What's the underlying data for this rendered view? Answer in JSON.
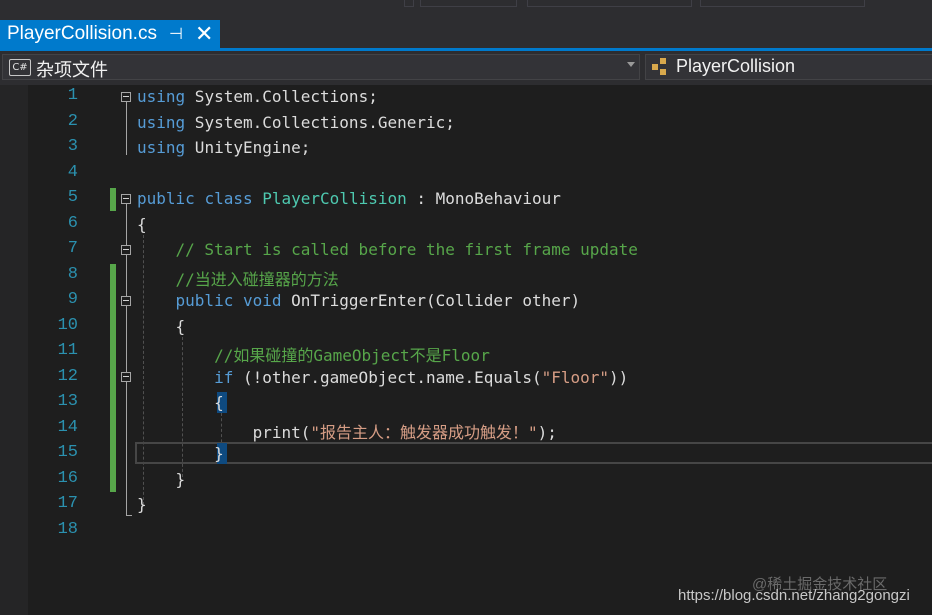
{
  "tab": {
    "filename": "PlayerCollision.cs",
    "pin_glyph": "⊣",
    "close_glyph": "✕"
  },
  "navigation": {
    "project_dropdown": {
      "icon": "C#",
      "label": "杂项文件"
    },
    "class_dropdown": {
      "label": "PlayerCollision"
    }
  },
  "editor": {
    "line_numbers": [
      "1",
      "2",
      "3",
      "4",
      "5",
      "6",
      "7",
      "8",
      "9",
      "10",
      "11",
      "12",
      "13",
      "14",
      "15",
      "16",
      "17",
      "18"
    ],
    "lines": [
      [
        {
          "t": "using",
          "c": "kw"
        },
        {
          "t": " System.Collections;",
          "c": ""
        }
      ],
      [
        {
          "t": "using",
          "c": "kw"
        },
        {
          "t": " System.Collections.Generic;",
          "c": ""
        }
      ],
      [
        {
          "t": "using",
          "c": "kw"
        },
        {
          "t": " UnityEngine;",
          "c": ""
        }
      ],
      [],
      [
        {
          "t": "public",
          "c": "kw"
        },
        {
          "t": " ",
          "c": ""
        },
        {
          "t": "class",
          "c": "kw"
        },
        {
          "t": " ",
          "c": ""
        },
        {
          "t": "PlayerCollision",
          "c": "ty"
        },
        {
          "t": " : MonoBehaviour",
          "c": ""
        }
      ],
      [
        {
          "t": "{",
          "c": ""
        }
      ],
      [
        {
          "t": "    // Start is called before the first frame update",
          "c": "cm"
        }
      ],
      [
        {
          "t": "    //当进入碰撞器的方法",
          "c": "cm"
        }
      ],
      [
        {
          "t": "    ",
          "c": ""
        },
        {
          "t": "public",
          "c": "kw"
        },
        {
          "t": " ",
          "c": ""
        },
        {
          "t": "void",
          "c": "kw"
        },
        {
          "t": " OnTriggerEnter(Collider other)",
          "c": ""
        }
      ],
      [
        {
          "t": "    {",
          "c": ""
        }
      ],
      [
        {
          "t": "        //如果碰撞的GameObject不是Floor",
          "c": "cm"
        }
      ],
      [
        {
          "t": "        ",
          "c": ""
        },
        {
          "t": "if",
          "c": "kw"
        },
        {
          "t": " (!other.gameObject.name.Equals(",
          "c": ""
        },
        {
          "t": "\"Floor\"",
          "c": "st"
        },
        {
          "t": "))",
          "c": ""
        }
      ],
      [
        {
          "t": "        {",
          "c": ""
        }
      ],
      [
        {
          "t": "            print(",
          "c": ""
        },
        {
          "t": "\"报告主人：触发器成功触发！\"",
          "c": "st"
        },
        {
          "t": ");",
          "c": ""
        }
      ],
      [
        {
          "t": "        }",
          "c": ""
        }
      ],
      [
        {
          "t": "    }",
          "c": ""
        }
      ],
      [
        {
          "t": "}",
          "c": ""
        }
      ],
      []
    ]
  },
  "watermark": {
    "site": "@稀土掘金技术社区",
    "url": "https://blog.csdn.net/zhang2gongzi"
  }
}
